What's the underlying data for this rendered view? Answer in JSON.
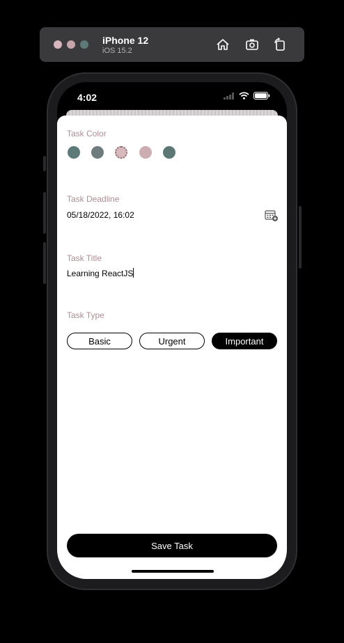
{
  "simulator": {
    "device_name": "iPhone 12",
    "os_version": "iOS 15.2",
    "icons": [
      "home-icon",
      "screenshot-icon",
      "rotate-icon"
    ]
  },
  "status_bar": {
    "time": "4:02",
    "icons": [
      "signal-icon",
      "wifi-icon",
      "battery-icon"
    ]
  },
  "form": {
    "color_label": "Task Color",
    "colors": [
      "#5e7a78",
      "#6f7c7d",
      "#d7b9bd",
      "#ccaeb2",
      "#5d7774"
    ],
    "selected_color_index": 2,
    "deadline_label": "Task Deadline",
    "deadline_value": "05/18/2022, 16:02",
    "title_label": "Task Title",
    "title_value": "Learning ReactJS",
    "type_label": "Task Type",
    "types": [
      "Basic",
      "Urgent",
      "Important"
    ],
    "selected_type": "Important",
    "save_label": "Save Task"
  },
  "theme": {
    "label_color": "#b08d92",
    "accent": "#000000"
  }
}
